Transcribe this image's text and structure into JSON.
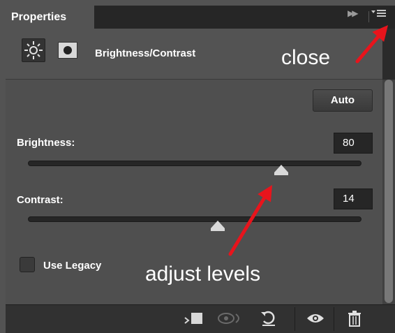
{
  "panel": {
    "tab_label": "Properties",
    "adjustment_title": "Brightness/Contrast",
    "auto_label": "Auto",
    "brightness": {
      "label": "Brightness:",
      "value": "80",
      "slider_fraction": 0.76
    },
    "contrast": {
      "label": "Contrast:",
      "value": "14",
      "slider_fraction": 0.57
    },
    "use_legacy_label": "Use Legacy",
    "use_legacy_checked": false
  },
  "annotations": {
    "close_text": "close",
    "adjust_text": "adjust levels",
    "arrow_color": "#e8141c"
  },
  "icons": {
    "adjustment": "brightness-sun-icon",
    "mask": "layer-mask-icon",
    "collapse": "double-arrow-collapse-icon",
    "menu": "panel-menu-icon",
    "footer": [
      "clip-to-layer-icon",
      "view-previous-state-icon",
      "reset-icon",
      "visibility-eye-icon",
      "trash-icon"
    ]
  }
}
